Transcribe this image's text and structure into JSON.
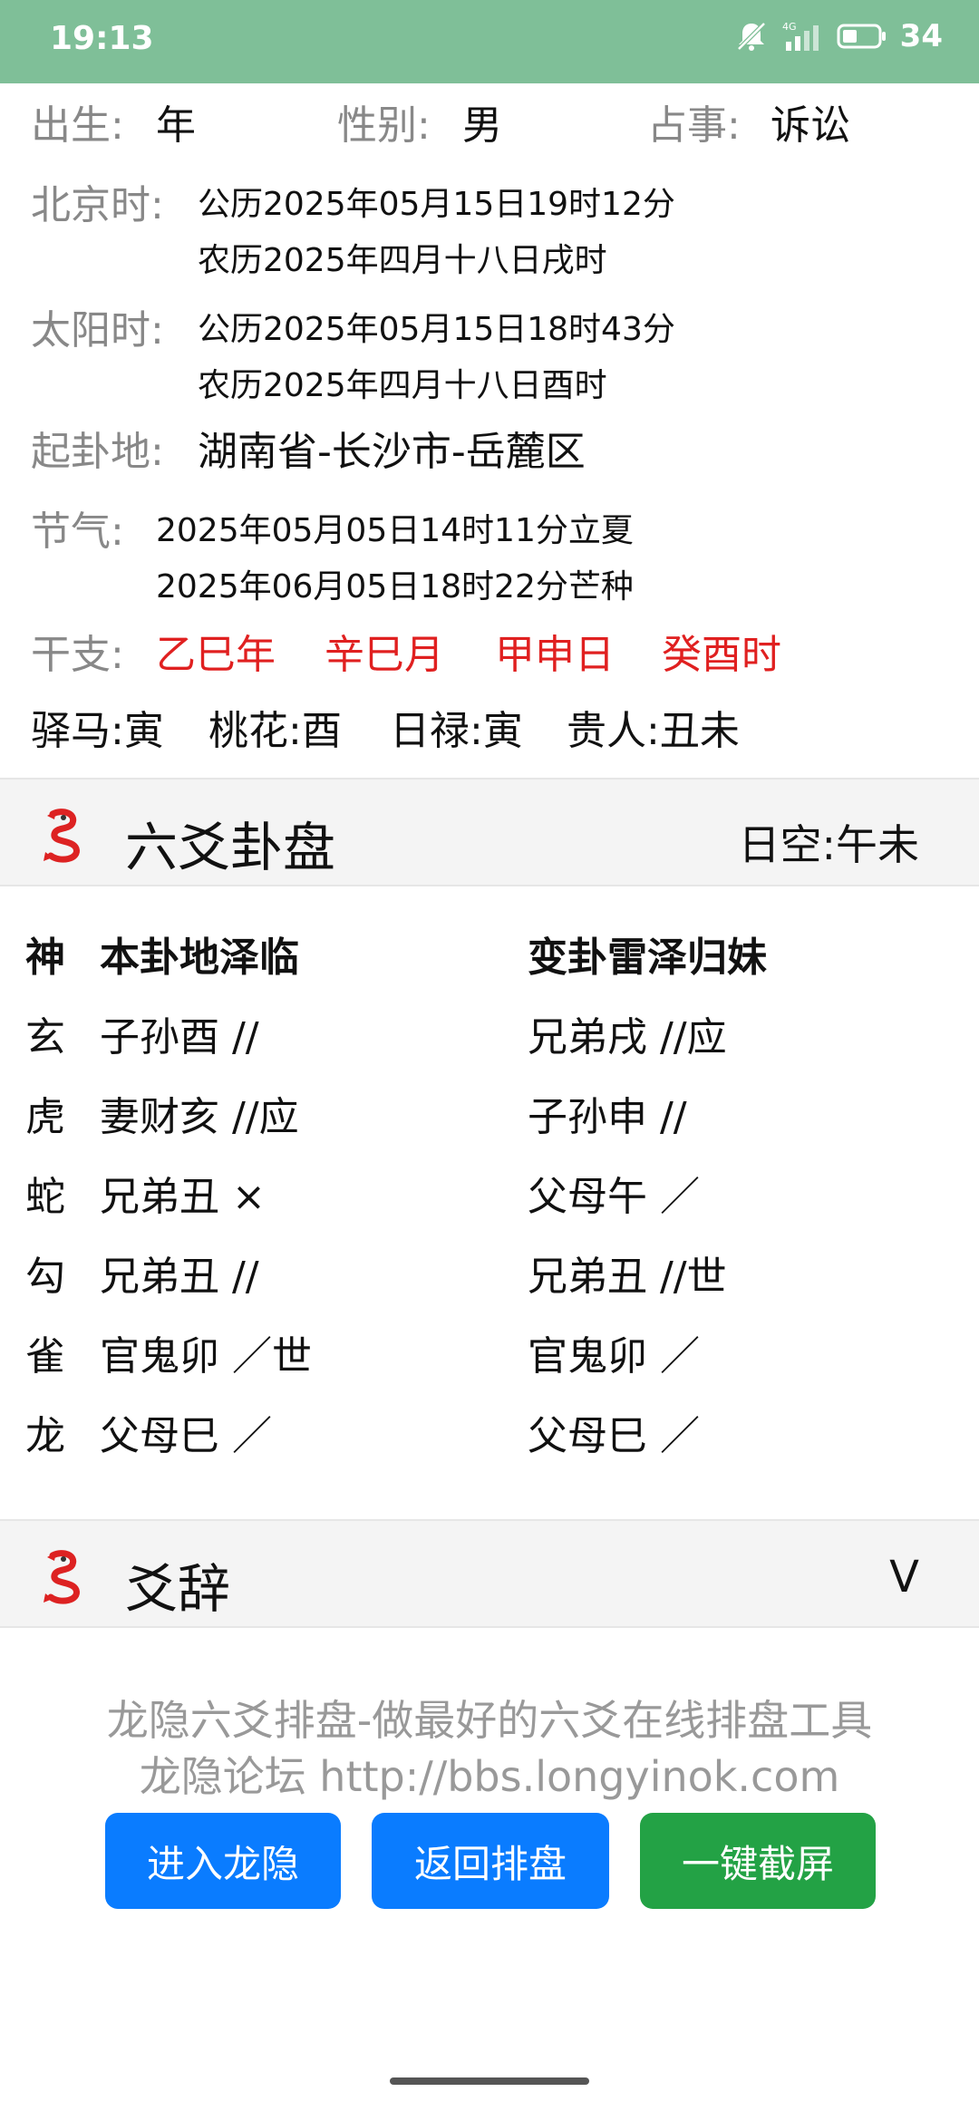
{
  "status_bar": {
    "time": "19:13",
    "battery": "34",
    "network": "4G"
  },
  "info": {
    "birth_label": "出生:",
    "birth_value": "年",
    "gender_label": "性别:",
    "gender_value": "男",
    "matter_label": "占事:",
    "matter_value": "诉讼",
    "beijing_label": "北京时:",
    "beijing_solar": "公历2025年05月15日19时12分",
    "beijing_lunar": "农历2025年四月十八日戌时",
    "sun_label": "太阳时:",
    "sun_solar": "公历2025年05月15日18时43分",
    "sun_lunar": "农历2025年四月十八日酉时",
    "place_label": "起卦地:",
    "place_value": "湖南省-长沙市-岳麓区",
    "solar_term_label": "节气:",
    "term1": "2025年05月05日14时11分立夏",
    "term2": "2025年06月05日18时22分芒种",
    "ganzhi_label": "干支:",
    "ganzhi": [
      "乙巳年",
      "辛巳月",
      "甲申日",
      "癸酉时"
    ],
    "shensha": [
      "驿马:寅",
      "桃花:酉",
      "日禄:寅",
      "贵人:丑未"
    ]
  },
  "gua_section": {
    "title": "六爻卦盘",
    "right_label": "日空:",
    "right_value": "午未",
    "header": {
      "shen": "神",
      "ben": "本卦地泽临",
      "bian": "变卦雷泽归妹"
    },
    "rows": [
      {
        "shen": "玄",
        "ben": "子孙酉 //",
        "bian": "兄弟戌 //应"
      },
      {
        "shen": "虎",
        "ben": "妻财亥 //应",
        "bian": "子孙申 //"
      },
      {
        "shen": "蛇",
        "ben": "兄弟丑 ×",
        "bian": "父母午 ／"
      },
      {
        "shen": "勾",
        "ben": "兄弟丑 //",
        "bian": "兄弟丑 //世"
      },
      {
        "shen": "雀",
        "ben": "官鬼卯 ／世",
        "bian": "官鬼卯 ／"
      },
      {
        "shen": "龙",
        "ben": "父母巳 ／",
        "bian": "父母巳 ／"
      }
    ]
  },
  "yaoci_section": {
    "title": "爻辞",
    "chevron": "V"
  },
  "footer": {
    "line1": "龙隐六爻排盘-做最好的六爻在线排盘工具",
    "line2": "龙隐论坛 http://bbs.longyinok.com",
    "buttons": [
      "进入龙隐",
      "返回排盘",
      "一键截屏"
    ]
  },
  "colors": {
    "status_bar": "#7fbf98",
    "red": "#e02020",
    "blue": "#0a7cff",
    "green": "#23a245"
  }
}
